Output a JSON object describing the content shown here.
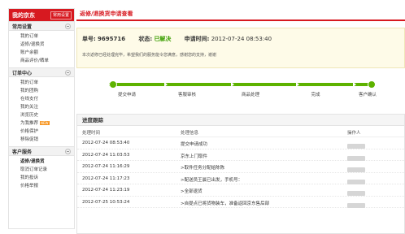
{
  "sidebar": {
    "brand": "我的京东",
    "settings_label": "常用设置",
    "groups": [
      {
        "title": "常用设置",
        "items": [
          "我的订单",
          "返修/退换货",
          "账户余额",
          "商品评价/晒单"
        ]
      },
      {
        "title": "订单中心",
        "items": [
          "我的订单",
          "我的团购",
          "在线支付",
          "我的关注",
          "浏览历史",
          "为我推荐",
          "价格保护",
          "移除促销"
        ],
        "hot_badge": "NEW"
      },
      {
        "title": "客户服务",
        "items": [
          "返修/退换货",
          "取消订单记录",
          "我的投诉",
          "价格举报"
        ]
      }
    ]
  },
  "main": {
    "title": "返修/退换货申请查看",
    "summary": {
      "order_label": "单号:",
      "order_no": "9695716",
      "status_label": "状态:",
      "status": "已解决",
      "time_label": "申请时间:",
      "apply_time": "2012-07-24 08:53:40",
      "note": "本次返修已经处理完毕，希望我们的服务能令您满意，感谢您的支持，谢谢"
    },
    "steps": [
      "提交申请",
      "客服审核",
      "商品处理",
      "完成",
      "客户确认"
    ],
    "tracking": {
      "title": "进度跟踪",
      "headers": {
        "time": "处理时间",
        "info": "处理信息",
        "operator": "操作人"
      },
      "rows": [
        {
          "time": "2012-07-24 08:53:40",
          "info": "提交申请成功"
        },
        {
          "time": "2012-07-24 11:03:53",
          "info": "京东上门取件"
        },
        {
          "time": "2012-07-24 11:16:29",
          "info": ">取件任务分配给陈陈"
        },
        {
          "time": "2012-07-24 11:17:23",
          "info": ">配送员王晨已出发，手机号："
        },
        {
          "time": "2012-07-24 11:23:19",
          "info": ">全部退货"
        },
        {
          "time": "2012-07-25 10:53:24",
          "info": ">自提点已将货物装车，准备返回京东售后部"
        }
      ]
    }
  }
}
